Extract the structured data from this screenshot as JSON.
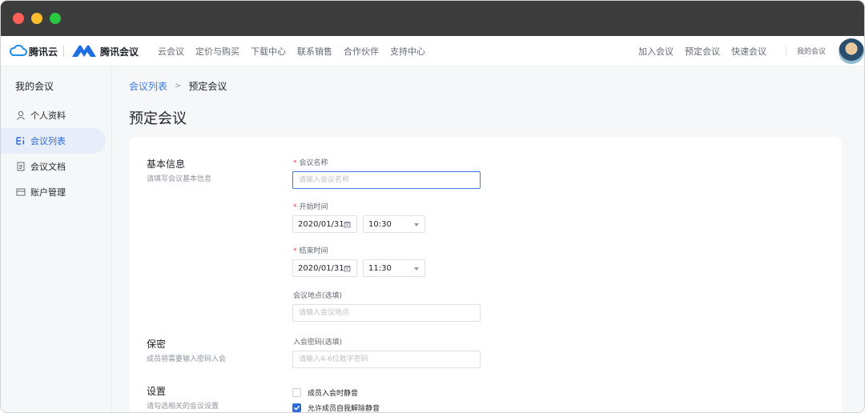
{
  "nav": {
    "brand_cloud": "腾讯云",
    "brand_meeting": "腾讯会议",
    "links": [
      "云会议",
      "定价与购买",
      "下载中心",
      "联系销售",
      "合作伙伴",
      "支持中心"
    ],
    "actions": [
      "加入会议",
      "预定会议",
      "快速会议"
    ],
    "my_meetings": "我的会议"
  },
  "sidebar": {
    "title": "我的会议",
    "items": [
      {
        "label": "个人资料",
        "icon": "user-icon"
      },
      {
        "label": "会议列表",
        "icon": "list-icon"
      },
      {
        "label": "会议文档",
        "icon": "document-icon"
      },
      {
        "label": "账户管理",
        "icon": "account-card-icon"
      }
    ],
    "active_index": 1
  },
  "breadcrumb": {
    "parent": "会议列表",
    "separator": ">",
    "current": "预定会议"
  },
  "page": {
    "title": "预定会议"
  },
  "form": {
    "basic": {
      "title": "基本信息",
      "desc": "请填写会议基本信息"
    },
    "name": {
      "label": "会议名称",
      "placeholder": "请输入会议名称",
      "value": ""
    },
    "start": {
      "label": "开始时间",
      "date": "2020/01/31",
      "time": "10:30"
    },
    "end": {
      "label": "结束时间",
      "date": "2020/01/31",
      "time": "11:30"
    },
    "location": {
      "label": "会议地点(选填)",
      "placeholder": "请输入会议地点",
      "value": ""
    },
    "secret": {
      "title": "保密",
      "desc": "成员将需要输入密码入会"
    },
    "password": {
      "label": "入会密码(选填)",
      "placeholder": "请输入4-6位数字密码",
      "value": ""
    },
    "settings": {
      "title": "设置",
      "desc": "请勾选相关的会议设置"
    },
    "options": [
      {
        "label": "成员入会时静音",
        "checked": false
      },
      {
        "label": "允许成员自我解除静音",
        "checked": true
      }
    ]
  },
  "colors": {
    "accent": "#2b6ad8",
    "required": "#e5484d",
    "titlebar": "#3c3c3c"
  }
}
